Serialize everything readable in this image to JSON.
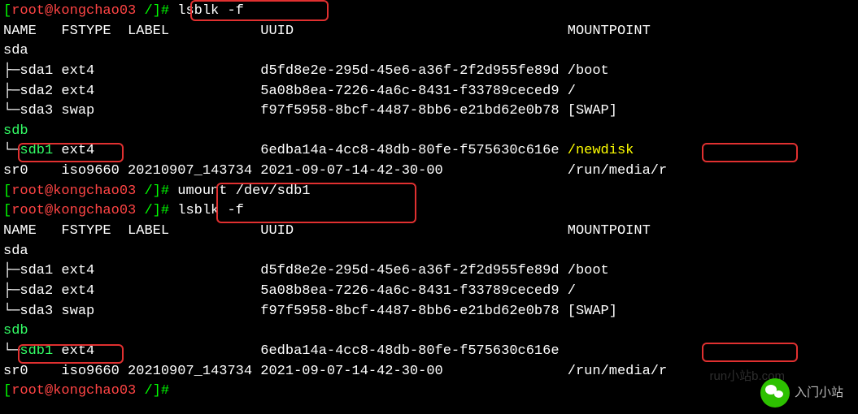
{
  "prompt": {
    "user_host": "root@kongchao03",
    "path": "/",
    "end": "#"
  },
  "commands": {
    "cmd1": "lsblk -f",
    "cmd2": "umount /dev/sdb1",
    "cmd3": "lsblk -f",
    "cmd4": ""
  },
  "headers": {
    "name": "NAME",
    "fstype": "FSTYPE",
    "label": "LABEL",
    "uuid": "UUID",
    "mountpoint": "MOUNTPOINT"
  },
  "devices1": {
    "sda": "sda",
    "sda1": {
      "name": "sda1",
      "fstype": "ext4",
      "uuid": "d5fd8e2e-295d-45e6-a36f-2f2d955fe89d",
      "mount": "/boot"
    },
    "sda2": {
      "name": "sda2",
      "fstype": "ext4",
      "uuid": "5a08b8ea-7226-4a6c-8431-f33789ceced9",
      "mount": "/"
    },
    "sda3": {
      "name": "sda3",
      "fstype": "swap",
      "uuid": "f97f5958-8bcf-4487-8bb6-e21bd62e0b78",
      "mount": "[SWAP]"
    },
    "sdb": "sdb",
    "sdb1": {
      "name": "sdb1",
      "fstype": "ext4",
      "uuid": "6edba14a-4cc8-48db-80fe-f575630c616e",
      "mount": "/newdisk"
    },
    "sr0": {
      "name": "sr0",
      "fstype": "iso9660",
      "label": "20210907_143734",
      "uuid": "2021-09-07-14-42-30-00",
      "mount": "/run/media/r"
    }
  },
  "devices2": {
    "sda": "sda",
    "sda1": {
      "name": "sda1",
      "fstype": "ext4",
      "uuid": "d5fd8e2e-295d-45e6-a36f-2f2d955fe89d",
      "mount": "/boot"
    },
    "sda2": {
      "name": "sda2",
      "fstype": "ext4",
      "uuid": "5a08b8ea-7226-4a6c-8431-f33789ceced9",
      "mount": "/"
    },
    "sda3": {
      "name": "sda3",
      "fstype": "swap",
      "uuid": "f97f5958-8bcf-4487-8bb6-e21bd62e0b78",
      "mount": "[SWAP]"
    },
    "sdb": "sdb",
    "sdb1": {
      "name": "sdb1",
      "fstype": "ext4",
      "uuid": "6edba14a-4cc8-48db-80fe-f575630c616e",
      "mount": ""
    },
    "sr0": {
      "name": "sr0",
      "fstype": "iso9660",
      "label": "20210907_143734",
      "uuid": "2021-09-07-14-42-30-00",
      "mount": "/run/media/r"
    }
  },
  "watermark": {
    "w1": "run小站b.com",
    "w2": "入门小站"
  }
}
